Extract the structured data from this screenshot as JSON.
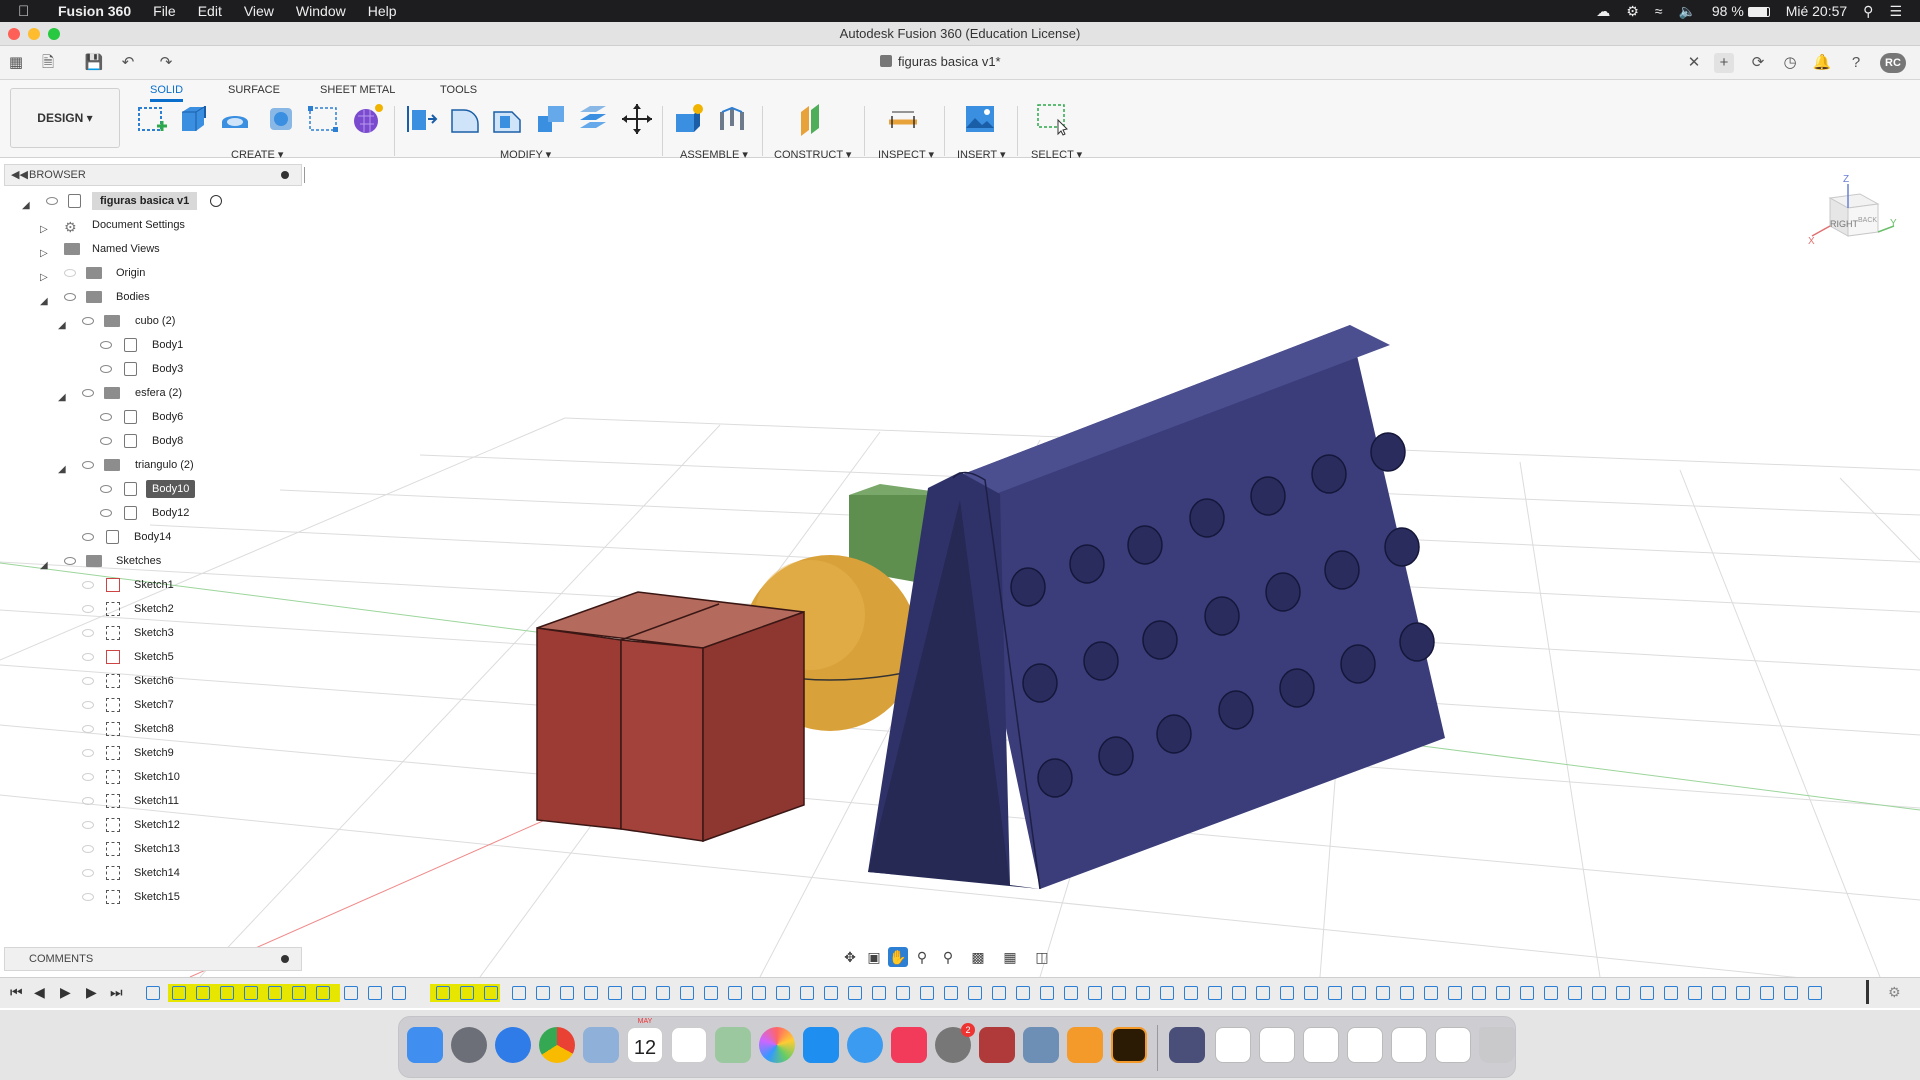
{
  "menubar": {
    "app_name": "Fusion 360",
    "items": [
      "File",
      "Edit",
      "View",
      "Window",
      "Help"
    ],
    "battery": "98 %",
    "clock": "Mié 20:57"
  },
  "window": {
    "title": "Autodesk Fusion 360 (Education License)",
    "doc_tab": "figuras basica v1*",
    "user_initials": "RC"
  },
  "ribbon": {
    "workspace": "DESIGN",
    "tabs": [
      "SOLID",
      "SURFACE",
      "SHEET METAL",
      "TOOLS"
    ],
    "groups": [
      "CREATE",
      "MODIFY",
      "ASSEMBLE",
      "CONSTRUCT",
      "INSPECT",
      "INSERT",
      "SELECT"
    ]
  },
  "browser": {
    "header": "BROWSER",
    "root": "figuras basica v1",
    "items": [
      {
        "label": "Document Settings"
      },
      {
        "label": "Named Views"
      },
      {
        "label": "Origin"
      },
      {
        "label": "Bodies"
      },
      {
        "label": "cubo (2)"
      },
      {
        "label": "Body1"
      },
      {
        "label": "Body3"
      },
      {
        "label": "esfera (2)"
      },
      {
        "label": "Body6"
      },
      {
        "label": "Body8"
      },
      {
        "label": "triangulo (2)"
      },
      {
        "label": "Body10"
      },
      {
        "label": "Body12"
      },
      {
        "label": "Body14"
      },
      {
        "label": "Sketches"
      },
      {
        "label": "Sketch1"
      },
      {
        "label": "Sketch2"
      },
      {
        "label": "Sketch3"
      },
      {
        "label": "Sketch5"
      },
      {
        "label": "Sketch6"
      },
      {
        "label": "Sketch7"
      },
      {
        "label": "Sketch8"
      },
      {
        "label": "Sketch9"
      },
      {
        "label": "Sketch10"
      },
      {
        "label": "Sketch11"
      },
      {
        "label": "Sketch12"
      },
      {
        "label": "Sketch13"
      },
      {
        "label": "Sketch14"
      },
      {
        "label": "Sketch15"
      }
    ]
  },
  "comments": {
    "label": "COMMENTS"
  },
  "viewcube": {
    "face": "RIGHT",
    "back": "BACK",
    "z": "Z",
    "x": "X",
    "y": "Y"
  },
  "dock": {
    "calendar_day": "12",
    "calendar_month": "MAY",
    "settings_badge": "2"
  },
  "colors": {
    "accent": "#0a6fcc",
    "cube": "#9b3b33",
    "sphere": "#d9a13a",
    "panel": "#3a3d7a",
    "wedge": "#5e8f4f"
  }
}
